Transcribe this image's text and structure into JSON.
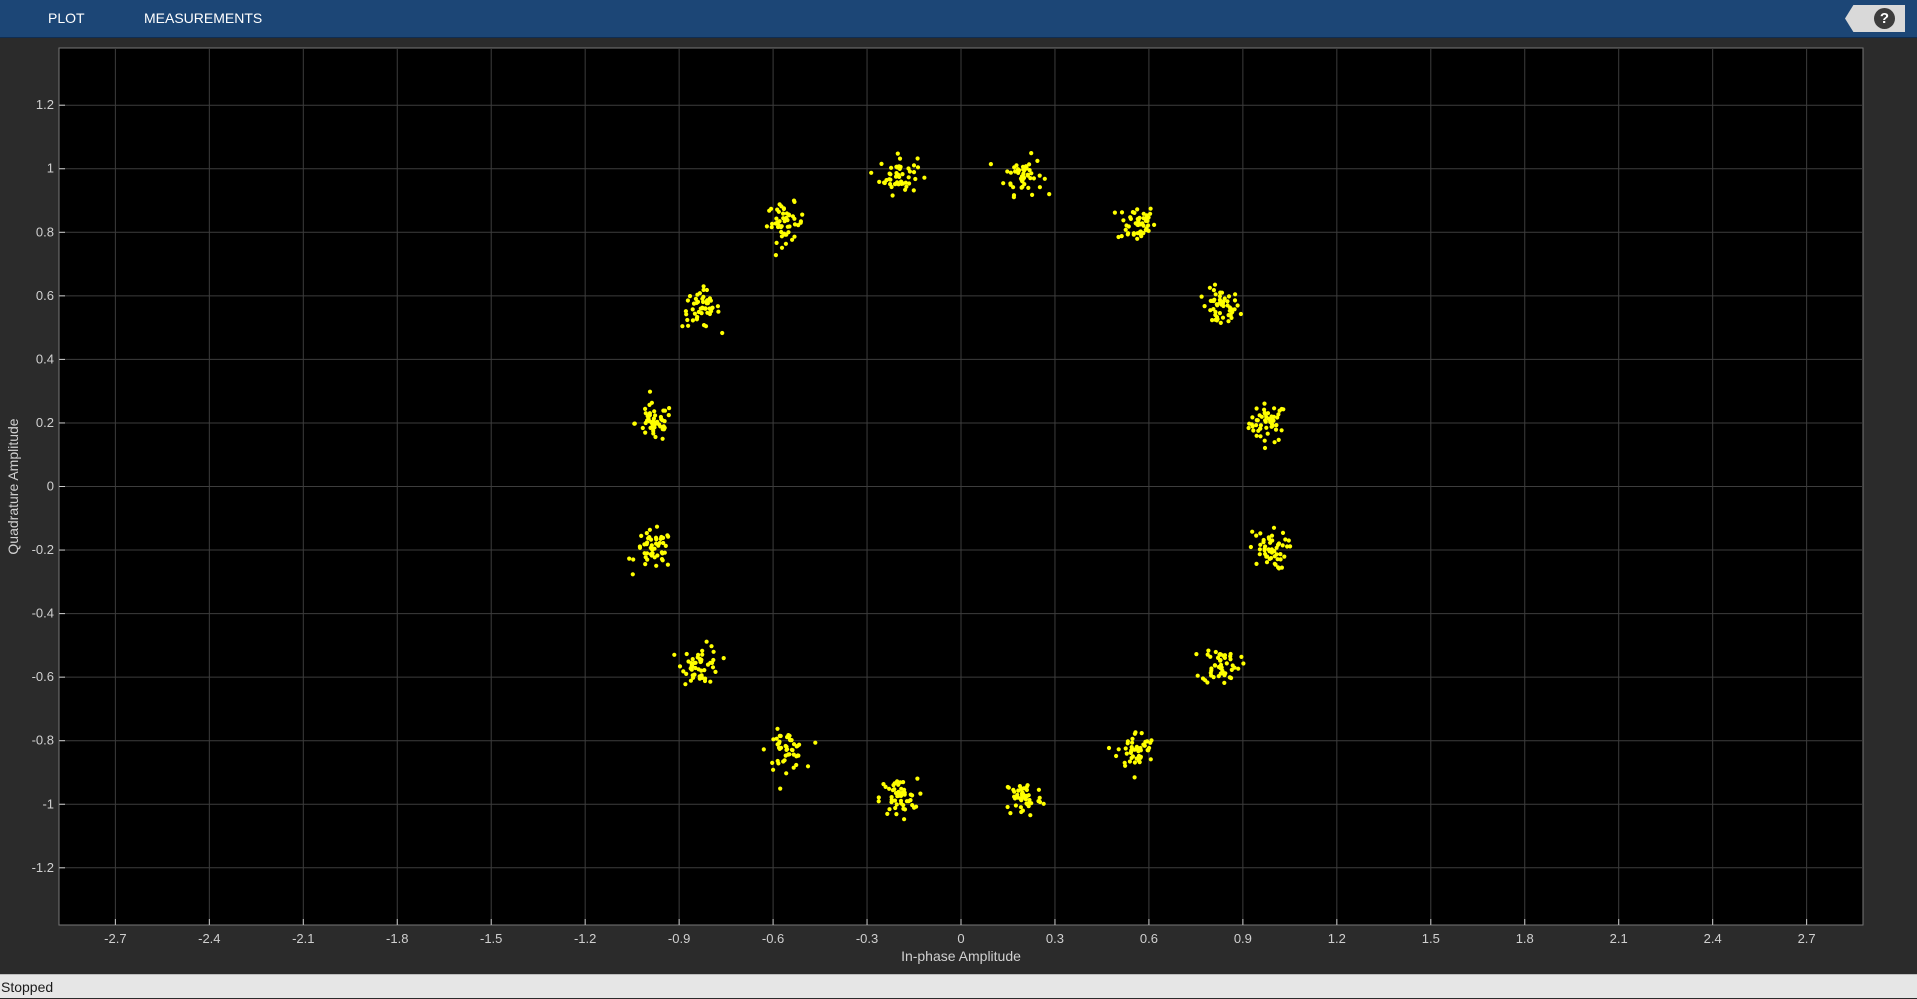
{
  "toolstrip": {
    "tabs": [
      "PLOT",
      "MEASUREMENTS"
    ],
    "help_icon": "question-mark-icon",
    "background": "#1c4676"
  },
  "status": {
    "text": "Stopped"
  },
  "chart_data": {
    "type": "scatter",
    "title": "",
    "xlabel": "In-phase Amplitude",
    "ylabel": "Quadrature Amplitude",
    "xlim": [
      -2.88,
      2.88
    ],
    "ylim": [
      -1.38,
      1.38
    ],
    "xticks": [
      -2.7,
      -2.4,
      -2.1,
      -1.8,
      -1.5,
      -1.2,
      -0.9,
      -0.6,
      -0.3,
      0,
      0.3,
      0.6,
      0.9,
      1.2,
      1.5,
      1.8,
      2.1,
      2.4,
      2.7
    ],
    "xtick_labels": [
      "-2.7",
      "-2.4",
      "-2.1",
      "-1.8",
      "-1.5",
      "-1.2",
      "-0.9",
      "-0.6",
      "-0.3",
      "0",
      "0.3",
      "0.6",
      "0.9",
      "1.2",
      "1.5",
      "1.8",
      "2.1",
      "2.4",
      "2.7"
    ],
    "yticks": [
      -1.2,
      -1,
      -0.8,
      -0.6,
      -0.4,
      -0.2,
      0,
      0.2,
      0.4,
      0.6,
      0.8,
      1,
      1.2
    ],
    "ytick_labels": [
      "-1.2",
      "-1",
      "-0.8",
      "-0.6",
      "-0.4",
      "-0.2",
      "0",
      "0.2",
      "0.4",
      "0.6",
      "0.8",
      "1",
      "1.2"
    ],
    "grid": true,
    "background": "#000000",
    "marker_color": "#ffff00",
    "cluster_centers": [
      [
        0.98,
        0.2
      ],
      [
        0.83,
        0.56
      ],
      [
        0.56,
        0.83
      ],
      [
        0.2,
        0.98
      ],
      [
        -0.2,
        0.98
      ],
      [
        -0.56,
        0.83
      ],
      [
        -0.83,
        0.56
      ],
      [
        -0.98,
        0.2
      ],
      [
        -0.98,
        -0.2
      ],
      [
        -0.83,
        -0.56
      ],
      [
        -0.56,
        -0.83
      ],
      [
        -0.2,
        -0.98
      ],
      [
        0.2,
        -0.98
      ],
      [
        0.56,
        -0.83
      ],
      [
        0.83,
        -0.56
      ],
      [
        0.98,
        -0.2
      ]
    ],
    "points_per_cluster": 50,
    "noise_std": 0.03
  }
}
